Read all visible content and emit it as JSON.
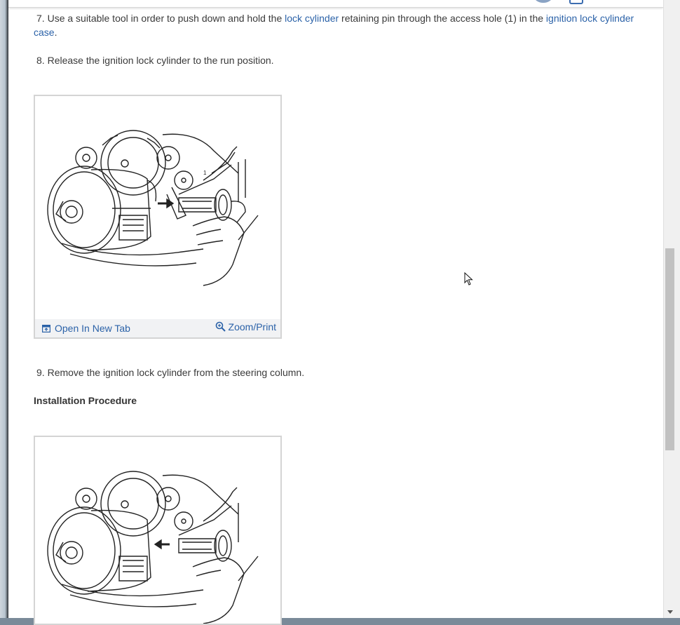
{
  "steps": {
    "step7": {
      "number": "7.",
      "text_a": "Use a suitable tool in order to push down and hold the ",
      "link_a": "lock cylinder",
      "text_b": " retaining pin through the access hole (1) in the ",
      "link_b": "ignition lock cylinder case",
      "text_c": "."
    },
    "step8": {
      "number": "8.",
      "text": "Release the ignition lock cylinder to the run position."
    },
    "step9": {
      "number": "9.",
      "text": "Remove the ignition lock cylinder from the steering column."
    }
  },
  "installation_heading": "Installation Procedure",
  "figure": {
    "open_tab_label": "Open In New Tab",
    "zoom_label": "Zoom/Print"
  },
  "icons": {
    "open_tab": "open-in-new-tab-icon",
    "zoom": "magnifier-zoom-icon",
    "cursor": "mouse-pointer-icon"
  },
  "colors": {
    "link": "#2b62a8",
    "text": "#3a3a3a",
    "figure_border": "#d4d4d4",
    "figure_bar": "#f1f2f4"
  }
}
